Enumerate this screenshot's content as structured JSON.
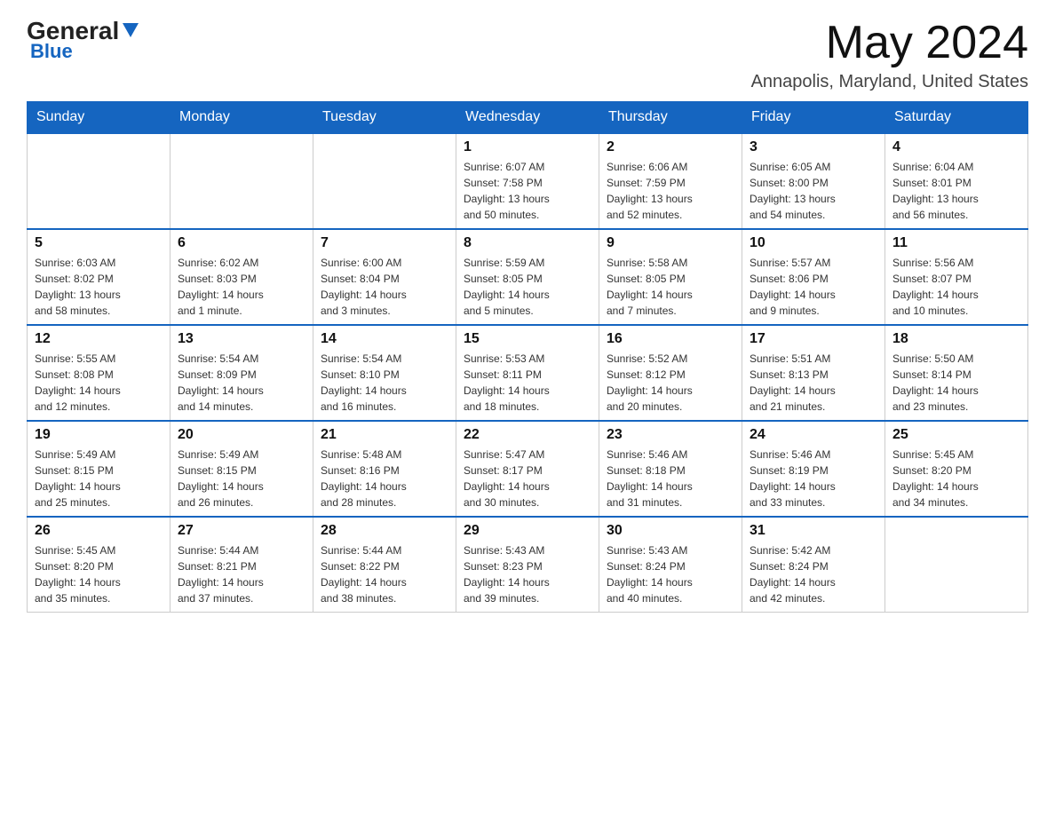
{
  "logo": {
    "general": "General",
    "blue": "Blue",
    "arrow_unicode": "▶"
  },
  "header": {
    "month_year": "May 2024",
    "location": "Annapolis, Maryland, United States"
  },
  "days_of_week": [
    "Sunday",
    "Monday",
    "Tuesday",
    "Wednesday",
    "Thursday",
    "Friday",
    "Saturday"
  ],
  "weeks": [
    [
      {
        "day": "",
        "info": ""
      },
      {
        "day": "",
        "info": ""
      },
      {
        "day": "",
        "info": ""
      },
      {
        "day": "1",
        "info": "Sunrise: 6:07 AM\nSunset: 7:58 PM\nDaylight: 13 hours\nand 50 minutes."
      },
      {
        "day": "2",
        "info": "Sunrise: 6:06 AM\nSunset: 7:59 PM\nDaylight: 13 hours\nand 52 minutes."
      },
      {
        "day": "3",
        "info": "Sunrise: 6:05 AM\nSunset: 8:00 PM\nDaylight: 13 hours\nand 54 minutes."
      },
      {
        "day": "4",
        "info": "Sunrise: 6:04 AM\nSunset: 8:01 PM\nDaylight: 13 hours\nand 56 minutes."
      }
    ],
    [
      {
        "day": "5",
        "info": "Sunrise: 6:03 AM\nSunset: 8:02 PM\nDaylight: 13 hours\nand 58 minutes."
      },
      {
        "day": "6",
        "info": "Sunrise: 6:02 AM\nSunset: 8:03 PM\nDaylight: 14 hours\nand 1 minute."
      },
      {
        "day": "7",
        "info": "Sunrise: 6:00 AM\nSunset: 8:04 PM\nDaylight: 14 hours\nand 3 minutes."
      },
      {
        "day": "8",
        "info": "Sunrise: 5:59 AM\nSunset: 8:05 PM\nDaylight: 14 hours\nand 5 minutes."
      },
      {
        "day": "9",
        "info": "Sunrise: 5:58 AM\nSunset: 8:05 PM\nDaylight: 14 hours\nand 7 minutes."
      },
      {
        "day": "10",
        "info": "Sunrise: 5:57 AM\nSunset: 8:06 PM\nDaylight: 14 hours\nand 9 minutes."
      },
      {
        "day": "11",
        "info": "Sunrise: 5:56 AM\nSunset: 8:07 PM\nDaylight: 14 hours\nand 10 minutes."
      }
    ],
    [
      {
        "day": "12",
        "info": "Sunrise: 5:55 AM\nSunset: 8:08 PM\nDaylight: 14 hours\nand 12 minutes."
      },
      {
        "day": "13",
        "info": "Sunrise: 5:54 AM\nSunset: 8:09 PM\nDaylight: 14 hours\nand 14 minutes."
      },
      {
        "day": "14",
        "info": "Sunrise: 5:54 AM\nSunset: 8:10 PM\nDaylight: 14 hours\nand 16 minutes."
      },
      {
        "day": "15",
        "info": "Sunrise: 5:53 AM\nSunset: 8:11 PM\nDaylight: 14 hours\nand 18 minutes."
      },
      {
        "day": "16",
        "info": "Sunrise: 5:52 AM\nSunset: 8:12 PM\nDaylight: 14 hours\nand 20 minutes."
      },
      {
        "day": "17",
        "info": "Sunrise: 5:51 AM\nSunset: 8:13 PM\nDaylight: 14 hours\nand 21 minutes."
      },
      {
        "day": "18",
        "info": "Sunrise: 5:50 AM\nSunset: 8:14 PM\nDaylight: 14 hours\nand 23 minutes."
      }
    ],
    [
      {
        "day": "19",
        "info": "Sunrise: 5:49 AM\nSunset: 8:15 PM\nDaylight: 14 hours\nand 25 minutes."
      },
      {
        "day": "20",
        "info": "Sunrise: 5:49 AM\nSunset: 8:15 PM\nDaylight: 14 hours\nand 26 minutes."
      },
      {
        "day": "21",
        "info": "Sunrise: 5:48 AM\nSunset: 8:16 PM\nDaylight: 14 hours\nand 28 minutes."
      },
      {
        "day": "22",
        "info": "Sunrise: 5:47 AM\nSunset: 8:17 PM\nDaylight: 14 hours\nand 30 minutes."
      },
      {
        "day": "23",
        "info": "Sunrise: 5:46 AM\nSunset: 8:18 PM\nDaylight: 14 hours\nand 31 minutes."
      },
      {
        "day": "24",
        "info": "Sunrise: 5:46 AM\nSunset: 8:19 PM\nDaylight: 14 hours\nand 33 minutes."
      },
      {
        "day": "25",
        "info": "Sunrise: 5:45 AM\nSunset: 8:20 PM\nDaylight: 14 hours\nand 34 minutes."
      }
    ],
    [
      {
        "day": "26",
        "info": "Sunrise: 5:45 AM\nSunset: 8:20 PM\nDaylight: 14 hours\nand 35 minutes."
      },
      {
        "day": "27",
        "info": "Sunrise: 5:44 AM\nSunset: 8:21 PM\nDaylight: 14 hours\nand 37 minutes."
      },
      {
        "day": "28",
        "info": "Sunrise: 5:44 AM\nSunset: 8:22 PM\nDaylight: 14 hours\nand 38 minutes."
      },
      {
        "day": "29",
        "info": "Sunrise: 5:43 AM\nSunset: 8:23 PM\nDaylight: 14 hours\nand 39 minutes."
      },
      {
        "day": "30",
        "info": "Sunrise: 5:43 AM\nSunset: 8:24 PM\nDaylight: 14 hours\nand 40 minutes."
      },
      {
        "day": "31",
        "info": "Sunrise: 5:42 AM\nSunset: 8:24 PM\nDaylight: 14 hours\nand 42 minutes."
      },
      {
        "day": "",
        "info": ""
      }
    ]
  ]
}
